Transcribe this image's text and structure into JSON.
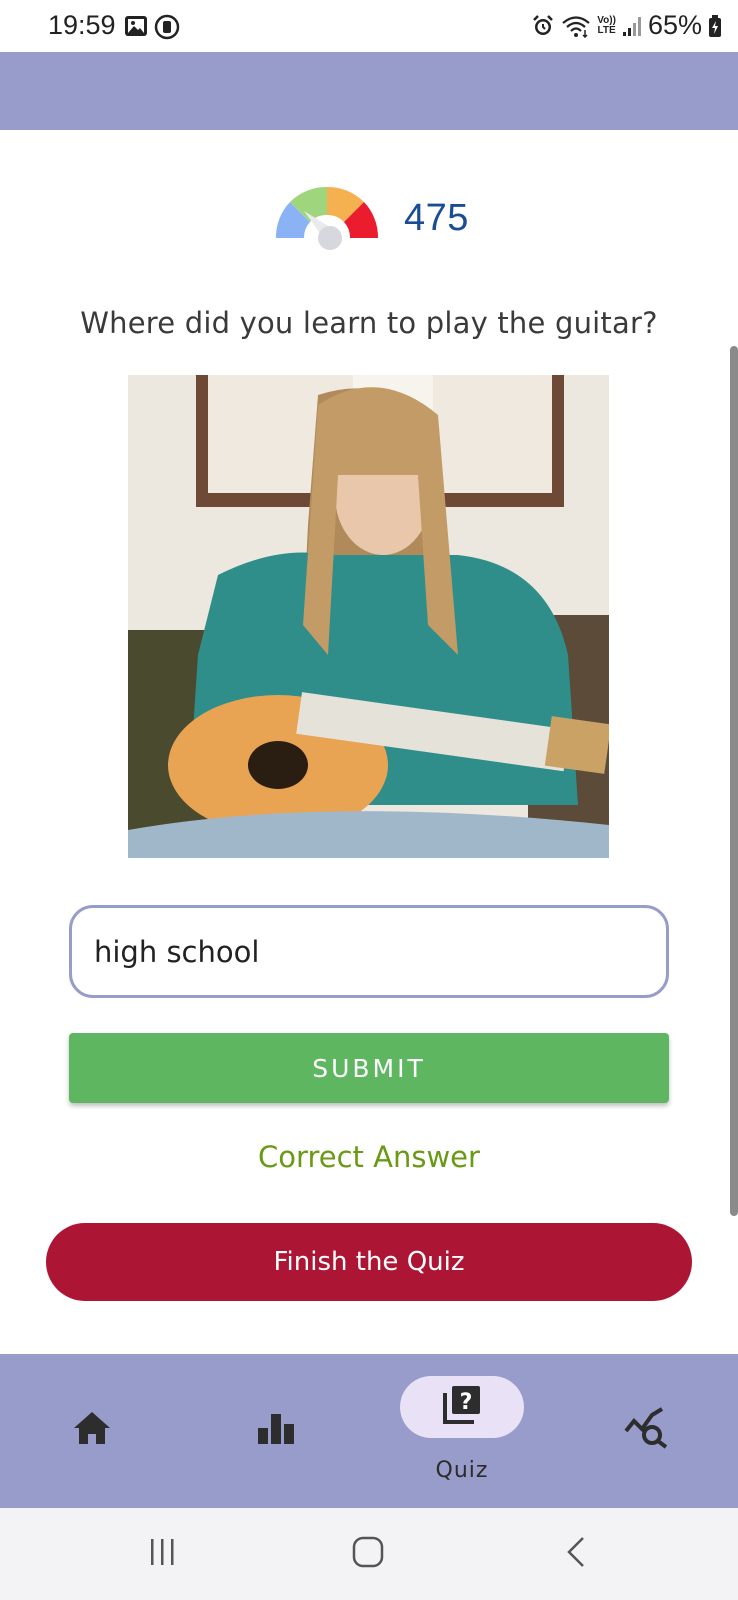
{
  "status_bar": {
    "time": "19:59",
    "lte_top": "Vo))",
    "lte_bottom": "LTE",
    "battery": "65%"
  },
  "score": {
    "value": "475",
    "gauge_icon": "speedometer-gauge-icon"
  },
  "question": {
    "text": "Where did you learn to play the guitar?"
  },
  "answer": {
    "value": "high school"
  },
  "buttons": {
    "submit": "SUBMIT",
    "finish": "Finish the Quiz"
  },
  "result": {
    "text": "Correct Answer"
  },
  "bottom_nav": {
    "items": [
      {
        "icon": "home-icon",
        "label": ""
      },
      {
        "icon": "bar-chart-icon",
        "label": ""
      },
      {
        "icon": "quiz-icon",
        "label": "Quiz",
        "active": true
      },
      {
        "icon": "chart-search-icon",
        "label": ""
      }
    ]
  },
  "colors": {
    "app_bar": "#979ccb",
    "score_text": "#1b4c97",
    "submit_green": "#5eb760",
    "finish_red": "#ad1535",
    "correct_green": "#6a9a14",
    "nav_active_pill": "#e9e1f6"
  }
}
